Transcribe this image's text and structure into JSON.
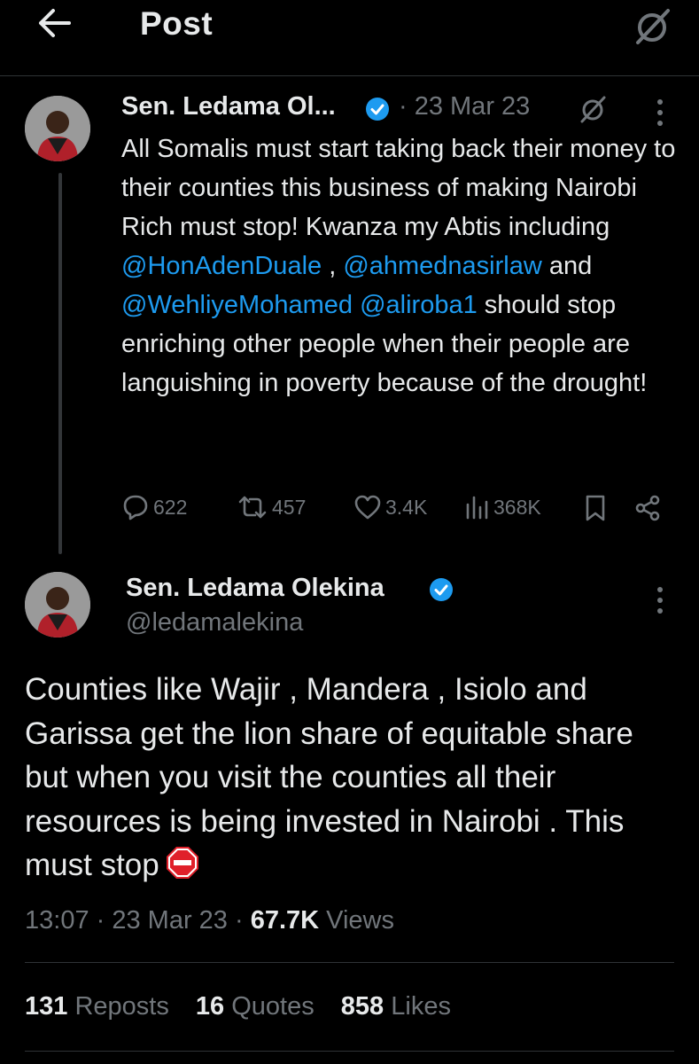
{
  "header": {
    "title": "Post",
    "back_icon": "arrow-left-icon",
    "grok_icon": "grok-icon"
  },
  "parent_post": {
    "author_name": "Sen. Ledama Ol...",
    "verified": true,
    "date": "· 23 Mar 23",
    "text_before_1": "All Somalis must start taking back their money to their counties this business of making Nairobi Rich must stop! Kwanza my Abtis including ",
    "mention_1": "@HonAdenDuale",
    "text_between_1": " , ",
    "mention_2": "@ahmednasirlaw",
    "text_between_2": " and ",
    "mention_3": "@WehliyeMohamed",
    "text_between_3": " ",
    "mention_4": "@aliroba1",
    "text_after": " should stop enriching other people when their people are languishing in poverty because of the drought!",
    "actions": {
      "replies": "622",
      "reposts": "457",
      "likes": "3.4K",
      "views": "368K"
    }
  },
  "main_post": {
    "author_name": "Sen. Ledama Olekina",
    "verified": true,
    "handle": "@ledamalekina",
    "text": "Counties like Wajir , Mandera , Isiolo and Garissa get the lion share of equitable share but when you visit the counties all their resources is being invested in Nairobi . This must stop",
    "emoji_icon": "stop-sign-icon",
    "meta": {
      "time": "13:07",
      "date": "23 Mar 23",
      "views_count": "67.7K",
      "views_label": "Views",
      "sep": " · "
    },
    "stats": {
      "reposts_count": "131",
      "reposts_label": "Reposts",
      "quotes_count": "16",
      "quotes_label": "Quotes",
      "likes_count": "858",
      "likes_label": "Likes"
    }
  },
  "colors": {
    "background": "#000000",
    "text": "#e7e9ea",
    "secondary_text": "#71767b",
    "link": "#1d9bf0",
    "verified": "#1d9bf0",
    "divider": "#2f3336"
  }
}
